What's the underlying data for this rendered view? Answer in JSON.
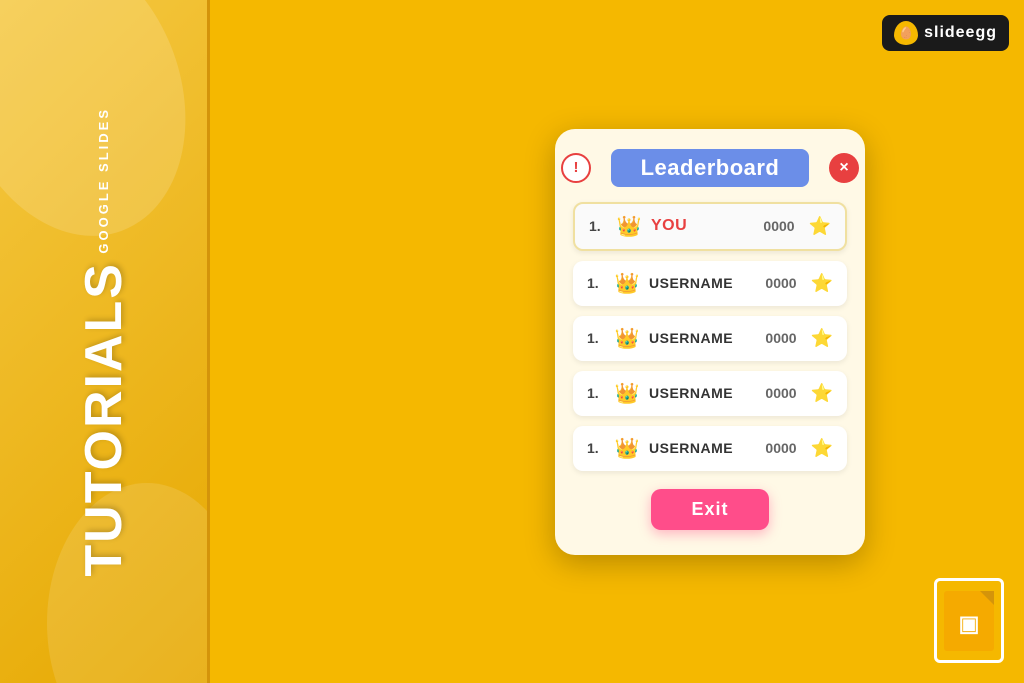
{
  "app": {
    "title": "Google Slides Tutorials - Leaderboard",
    "background_color": "#F5B800"
  },
  "sidebar": {
    "google_slides_label": "GOOGLE SLIDES",
    "tutorials_label": "TUTORIALS"
  },
  "logo": {
    "brand_name": "slideegg",
    "egg_icon": "🥚"
  },
  "leaderboard": {
    "title": "Leaderboard",
    "info_icon": "!",
    "close_icon": "×",
    "rows": [
      {
        "rank": "1.",
        "crown_emoji": "👑",
        "name": "YOU",
        "score": "0000",
        "star": "⭐",
        "is_highlight": true,
        "is_first": true
      },
      {
        "rank": "1.",
        "crown_emoji": "👑",
        "name": "USERNAME",
        "score": "0000",
        "star": "⭐",
        "is_highlight": false,
        "is_first": false
      },
      {
        "rank": "1.",
        "crown_emoji": "👑",
        "name": "USERNAME",
        "score": "0000",
        "star": "⭐",
        "is_highlight": false,
        "is_first": false
      },
      {
        "rank": "1.",
        "crown_emoji": "👑",
        "name": "USERNAME",
        "score": "0000",
        "star": "⭐",
        "is_highlight": false,
        "is_first": false
      },
      {
        "rank": "1.",
        "crown_emoji": "👑",
        "name": "USERNAME",
        "score": "0000",
        "star": "⭐",
        "is_highlight": false,
        "is_first": false
      }
    ],
    "exit_button_label": "Exit"
  },
  "slides_icon": {
    "symbol": "▣"
  }
}
